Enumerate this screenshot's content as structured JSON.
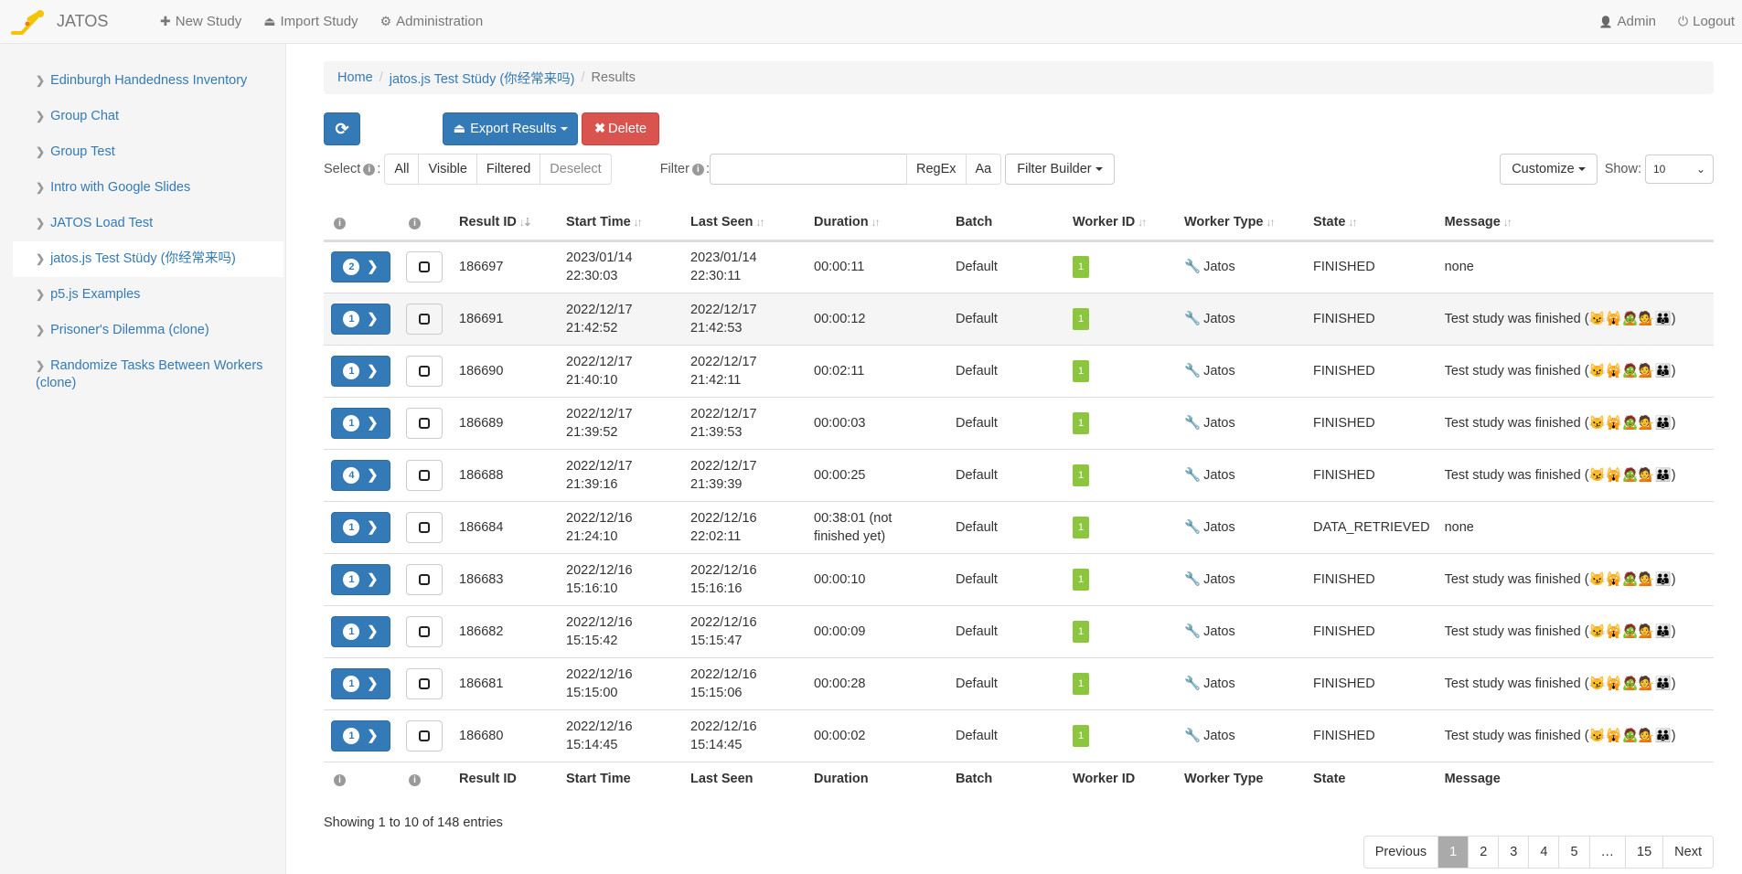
{
  "navbar": {
    "brand": "JATOS",
    "items": [
      {
        "icon": "plus-icon",
        "glyph": "✚",
        "label": "New Study"
      },
      {
        "icon": "import-icon",
        "glyph": "⏏",
        "label": "Import Study"
      },
      {
        "icon": "gear-icon",
        "glyph": "⚙",
        "label": "Administration"
      }
    ],
    "user": {
      "icon": "user-icon",
      "glyph": "👤",
      "label": "Admin"
    },
    "logout": {
      "icon": "power-icon",
      "glyph": "⏻",
      "label": "Logout"
    }
  },
  "sidebar": {
    "items": [
      {
        "label": "Edinburgh Handedness Inventory"
      },
      {
        "label": "Group Chat"
      },
      {
        "label": "Group Test"
      },
      {
        "label": "Intro with Google Slides"
      },
      {
        "label": "JATOS Load Test"
      },
      {
        "label": "jatos.js Test Stüdy (你经常来吗)",
        "active": true
      },
      {
        "label": "p5.js Examples"
      },
      {
        "label": "Prisoner's Dilemma (clone)"
      },
      {
        "label": "Randomize Tasks Between Workers (clone)"
      }
    ]
  },
  "breadcrumb": {
    "home": "Home",
    "study": "jatos.js Test Stüdy (你经常来吗)",
    "current": "Results",
    "separator": "/"
  },
  "toolbar": {
    "refresh_glyph": "⟳",
    "export_label": "Export Results",
    "delete_label": "Delete"
  },
  "filters": {
    "select_label": "Select",
    "select_options": [
      "All",
      "Visible",
      "Filtered",
      "Deselect"
    ],
    "filter_label": "Filter",
    "filter_value": "",
    "regex_label": "RegEx",
    "case_label": "Aa",
    "filter_builder_label": "Filter Builder",
    "customize_label": "Customize",
    "show_label": "Show:",
    "show_value": "10"
  },
  "table": {
    "columns": [
      "",
      "",
      "Result ID",
      "Start Time",
      "Last Seen",
      "Duration",
      "Batch",
      "Worker ID",
      "Worker Type",
      "State",
      "Message"
    ],
    "rows": [
      {
        "count": "2",
        "id": "186697",
        "start_date": "2023/01/14",
        "start_time": "22:30:03",
        "seen_date": "2023/01/14",
        "seen_time": "22:30:11",
        "duration": "00:00:11",
        "batch": "Default",
        "worker_id": "1",
        "worker_type": "Jatos",
        "state": "FINISHED",
        "message": "none"
      },
      {
        "count": "1",
        "id": "186691",
        "start_date": "2022/12/17",
        "start_time": "21:42:52",
        "seen_date": "2022/12/17",
        "seen_time": "21:42:53",
        "duration": "00:00:12",
        "batch": "Default",
        "worker_id": "1",
        "worker_type": "Jatos",
        "state": "FINISHED",
        "message": "Test study was finished (😼🙀🧟💁👪)"
      },
      {
        "count": "1",
        "id": "186690",
        "start_date": "2022/12/17",
        "start_time": "21:40:10",
        "seen_date": "2022/12/17",
        "seen_time": "21:42:11",
        "duration": "00:02:11",
        "batch": "Default",
        "worker_id": "1",
        "worker_type": "Jatos",
        "state": "FINISHED",
        "message": "Test study was finished (😼🙀🧟💁👪)"
      },
      {
        "count": "1",
        "id": "186689",
        "start_date": "2022/12/17",
        "start_time": "21:39:52",
        "seen_date": "2022/12/17",
        "seen_time": "21:39:53",
        "duration": "00:00:03",
        "batch": "Default",
        "worker_id": "1",
        "worker_type": "Jatos",
        "state": "FINISHED",
        "message": "Test study was finished (😼🙀🧟💁👪)"
      },
      {
        "count": "4",
        "id": "186688",
        "start_date": "2022/12/17",
        "start_time": "21:39:16",
        "seen_date": "2022/12/17",
        "seen_time": "21:39:39",
        "duration": "00:00:25",
        "batch": "Default",
        "worker_id": "1",
        "worker_type": "Jatos",
        "state": "FINISHED",
        "message": "Test study was finished (😼🙀🧟💁👪)"
      },
      {
        "count": "1",
        "id": "186684",
        "start_date": "2022/12/16",
        "start_time": "21:24:10",
        "seen_date": "2022/12/16",
        "seen_time": "22:02:11",
        "duration": "00:38:01 (not finished yet)",
        "batch": "Default",
        "worker_id": "1",
        "worker_type": "Jatos",
        "state": "DATA_RETRIEVED",
        "message": "none"
      },
      {
        "count": "1",
        "id": "186683",
        "start_date": "2022/12/16",
        "start_time": "15:16:10",
        "seen_date": "2022/12/16",
        "seen_time": "15:16:16",
        "duration": "00:00:10",
        "batch": "Default",
        "worker_id": "1",
        "worker_type": "Jatos",
        "state": "FINISHED",
        "message": "Test study was finished (😼🙀🧟💁👪)"
      },
      {
        "count": "1",
        "id": "186682",
        "start_date": "2022/12/16",
        "start_time": "15:15:42",
        "seen_date": "2022/12/16",
        "seen_time": "15:15:47",
        "duration": "00:00:09",
        "batch": "Default",
        "worker_id": "1",
        "worker_type": "Jatos",
        "state": "FINISHED",
        "message": "Test study was finished (😼🙀🧟💁👪)"
      },
      {
        "count": "1",
        "id": "186681",
        "start_date": "2022/12/16",
        "start_time": "15:15:00",
        "seen_date": "2022/12/16",
        "seen_time": "15:15:06",
        "duration": "00:00:28",
        "batch": "Default",
        "worker_id": "1",
        "worker_type": "Jatos",
        "state": "FINISHED",
        "message": "Test study was finished (😼🙀🧟💁👪)"
      },
      {
        "count": "1",
        "id": "186680",
        "start_date": "2022/12/16",
        "start_time": "15:14:45",
        "seen_date": "2022/12/16",
        "seen_time": "15:14:45",
        "duration": "00:00:02",
        "batch": "Default",
        "worker_id": "1",
        "worker_type": "Jatos",
        "state": "FINISHED",
        "message": "Test study was finished (😼🙀🧟💁👪)"
      }
    ]
  },
  "footer": {
    "info": "Showing 1 to 10 of 148 entries",
    "pages": [
      "Previous",
      "1",
      "2",
      "3",
      "4",
      "5",
      "…",
      "15",
      "Next"
    ],
    "active_page": "1"
  }
}
